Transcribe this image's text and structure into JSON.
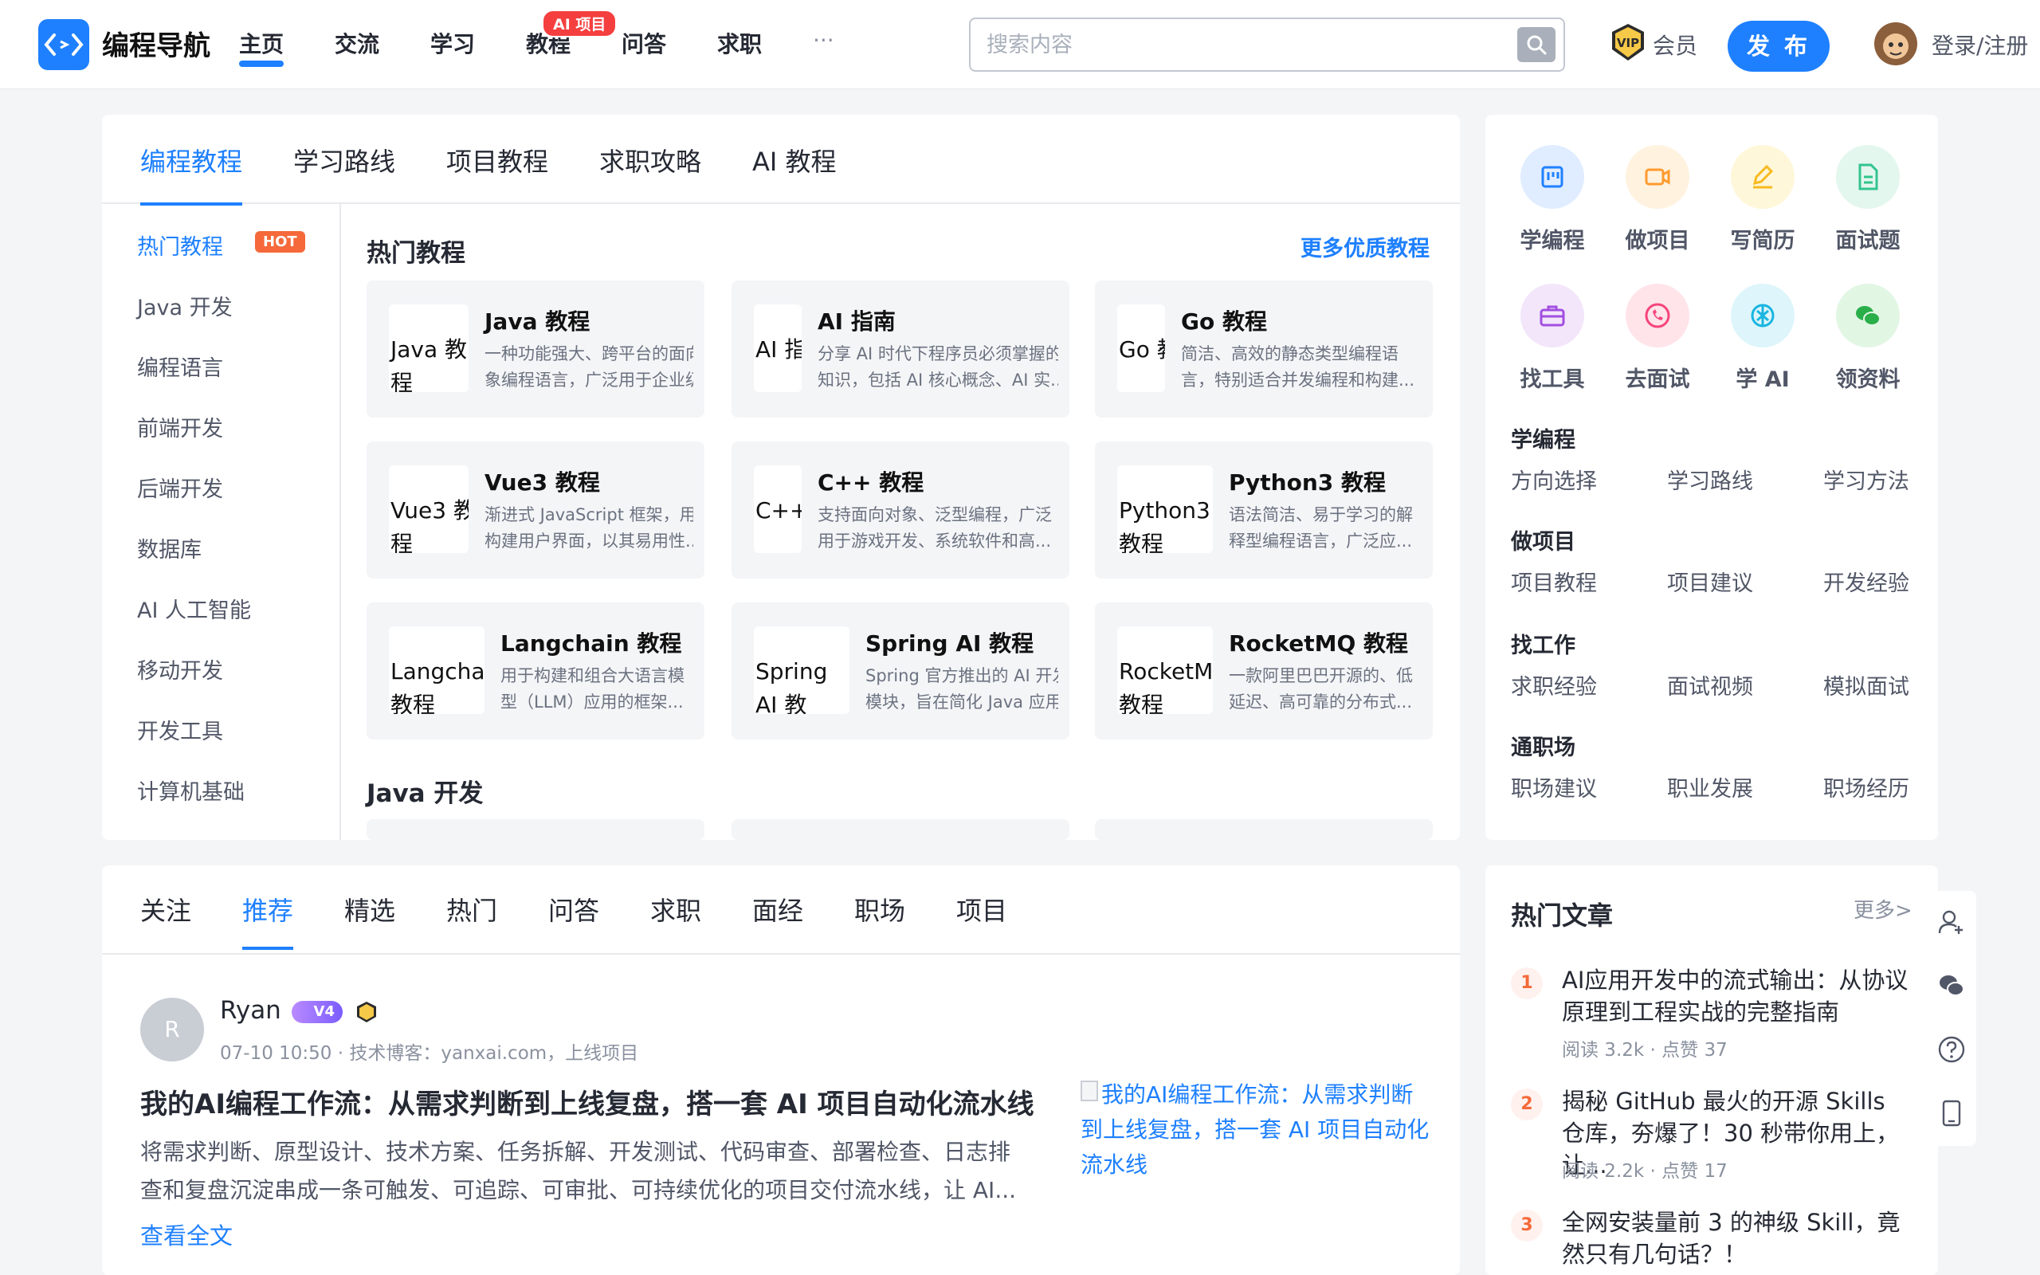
{
  "header": {
    "site_name": "编程导航",
    "nav": [
      "主页",
      "交流",
      "学习",
      "教程",
      "问答",
      "求职",
      "···"
    ],
    "nav_badge": "AI 项目",
    "search_placeholder": "搜索内容",
    "vip_label": "会员",
    "publish_label": "发 布",
    "login_label": "登录/注册"
  },
  "tutorials": {
    "tabs": [
      "编程教程",
      "学习路线",
      "项目教程",
      "求职攻略",
      "AI 教程"
    ],
    "sidebar": [
      "热门教程",
      "Java 开发",
      "编程语言",
      "前端开发",
      "后端开发",
      "数据库",
      "AI 人工智能",
      "移动开发",
      "开发工具",
      "计算机基础"
    ],
    "hot_badge": "HOT",
    "section_title": "热门教程",
    "more_link": "更多优质教程",
    "items": [
      {
        "name": "Java 教程",
        "alt": "Java 教程",
        "d1": "一种功能强大、跨平台的面向对",
        "d2": "象编程语言，广泛用于企业级..."
      },
      {
        "name": "AI 指南",
        "alt": "AI 指",
        "d1": "分享 AI 时代下程序员必须掌握的",
        "d2": "知识，包括 AI 核心概念、AI 实..."
      },
      {
        "name": "Go 教程",
        "alt": "Go 教",
        "d1": "简洁、高效的静态类型编程语",
        "d2": "言，特别适合并发编程和构建..."
      },
      {
        "name": "Vue3 教程",
        "alt": "Vue3 教程",
        "d1": "渐进式 JavaScript 框架，用于",
        "d2": "构建用户界面，以其易用性..."
      },
      {
        "name": "C++ 教程",
        "alt": "C++ 教",
        "d1": "支持面向对象、泛型编程，广泛",
        "d2": "用于游戏开发、系统软件和高..."
      },
      {
        "name": "Python3 教程",
        "alt": "Python3 教程",
        "d1": "语法简洁、易于学习的解",
        "d2": "释型编程语言，广泛应..."
      },
      {
        "name": "Langchain 教程",
        "alt": "Langcha 教程",
        "d1": "用于构建和组合大语言模",
        "d2": "型（LLM）应用的框架..."
      },
      {
        "name": "Spring AI 教程",
        "alt": "Spring AI 教",
        "d1": "Spring 官方推出的 AI 开发",
        "d2": "模块，旨在简化 Java 应用..."
      },
      {
        "name": "RocketMQ 教程",
        "alt": "RocketM 教程",
        "d1": "一款阿里巴巴开源的、低",
        "d2": "延迟、高可靠的分布式..."
      }
    ],
    "section2_title": "Java 开发"
  },
  "quick": {
    "items": [
      {
        "label": "学编程",
        "icon": "board-icon",
        "bg": "#e0ecff",
        "fg": "#1e80ff"
      },
      {
        "label": "做项目",
        "icon": "video-icon",
        "bg": "#fff2df",
        "fg": "#ff9a2e"
      },
      {
        "label": "写简历",
        "icon": "pen-icon",
        "bg": "#fff7d9",
        "fg": "#f7ba1e"
      },
      {
        "label": "面试题",
        "icon": "document-icon",
        "bg": "#e3f7ee",
        "fg": "#32c48d"
      },
      {
        "label": "找工具",
        "icon": "toolbox-icon",
        "bg": "#f3e6fb",
        "fg": "#a24ee0"
      },
      {
        "label": "去面试",
        "icon": "phone-icon",
        "bg": "#ffe4ea",
        "fg": "#f5457a"
      },
      {
        "label": "学 AI",
        "icon": "ai-icon",
        "bg": "#ddf5fb",
        "fg": "#19b5e0"
      },
      {
        "label": "领资料",
        "icon": "chat-icon",
        "bg": "#e2f6e4",
        "fg": "#2aae4a"
      }
    ],
    "groups": [
      {
        "title": "学编程",
        "links": [
          "方向选择",
          "学习路线",
          "学习方法"
        ]
      },
      {
        "title": "做项目",
        "links": [
          "项目教程",
          "项目建议",
          "开发经验"
        ]
      },
      {
        "title": "找工作",
        "links": [
          "求职经验",
          "面试视频",
          "模拟面试"
        ]
      },
      {
        "title": "通职场",
        "links": [
          "职场建议",
          "职业发展",
          "职场经历"
        ]
      }
    ]
  },
  "feed": {
    "tabs": [
      "关注",
      "推荐",
      "精选",
      "热门",
      "问答",
      "求职",
      "面经",
      "职场",
      "项目"
    ],
    "post": {
      "avatar_letter": "R",
      "author": "Ryan",
      "level": "V4",
      "meta": "07-10 10:50 · 技术博客：yanxai.com，上线项目",
      "title": "我的AI编程工作流：从需求判断到上线复盘，搭一套 AI 项目自动化流水线",
      "excerpt1": "将需求判断、原型设计、技术方案、任务拆解、开发测试、代码审查、部署检查、日志排",
      "excerpt2": "查和复盘沉淀串成一条可触发、可追踪、可审批、可持续优化的项目交付流水线，让 AI...",
      "read_more": "查看全文",
      "image_alt": "我的AI编程工作流：从需求判断到上线复盘，搭一套 AI 项目自动化流水线"
    }
  },
  "hot_articles": {
    "title": "热门文章",
    "more": "更多>",
    "items": [
      {
        "rank": "1",
        "title": "AI应用开发中的流式输出：从协议原理到工程实战的完整指南",
        "meta": "阅读 3.2k  ·  点赞 37"
      },
      {
        "rank": "2",
        "title": "揭秘 GitHub 最火的开源 Skills 仓库，夯爆了！30 秒带你用上，让...",
        "meta": "阅读 2.2k  ·  点赞 17"
      },
      {
        "rank": "3",
        "title": "全网安装量前 3 的神级 Skill，竟然只有几句话？！",
        "meta": ""
      }
    ]
  }
}
